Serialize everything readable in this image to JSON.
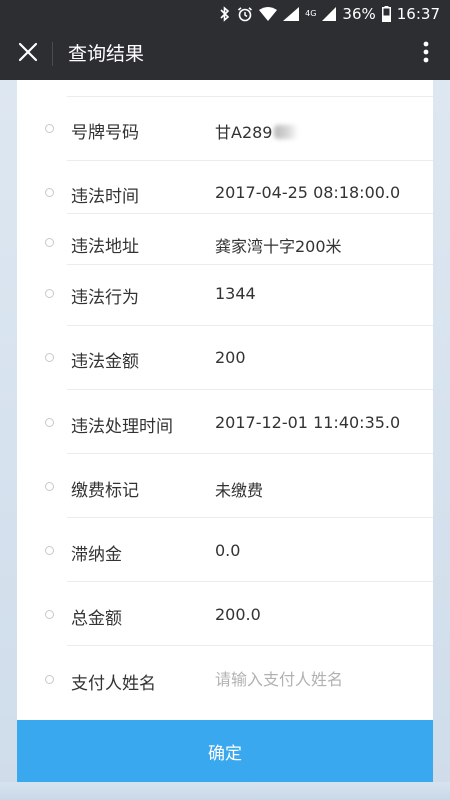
{
  "status_bar": {
    "battery_percent": "36%",
    "time": "16:37",
    "network_label": "4G"
  },
  "header": {
    "title": "查询结果"
  },
  "rows": [
    {
      "label": "号牌号码",
      "value": "甘A289"
    },
    {
      "label": "违法时间",
      "value": "2017-04-25 08:18:00.0"
    },
    {
      "label": "违法地址",
      "value": "龚家湾十字200米"
    },
    {
      "label": "违法行为",
      "value": "1344"
    },
    {
      "label": "违法金额",
      "value": "200"
    },
    {
      "label": "违法处理时间",
      "value": "2017-12-01 11:40:35.0"
    },
    {
      "label": "缴费标记",
      "value": "未缴费"
    },
    {
      "label": "滞纳金",
      "value": "0.0"
    },
    {
      "label": "总金额",
      "value": "200.0"
    }
  ],
  "payer": {
    "label": "支付人姓名",
    "value": "",
    "placeholder": "请输入支付人姓名"
  },
  "confirm_label": "确定",
  "colors": {
    "nav_background": "#2d2e32",
    "button_blue": "#3aa8ee",
    "page_background": "#dfe8f2"
  },
  "icons": {
    "nav_left": "close-icon",
    "nav_right": "more-vertical-icon"
  }
}
